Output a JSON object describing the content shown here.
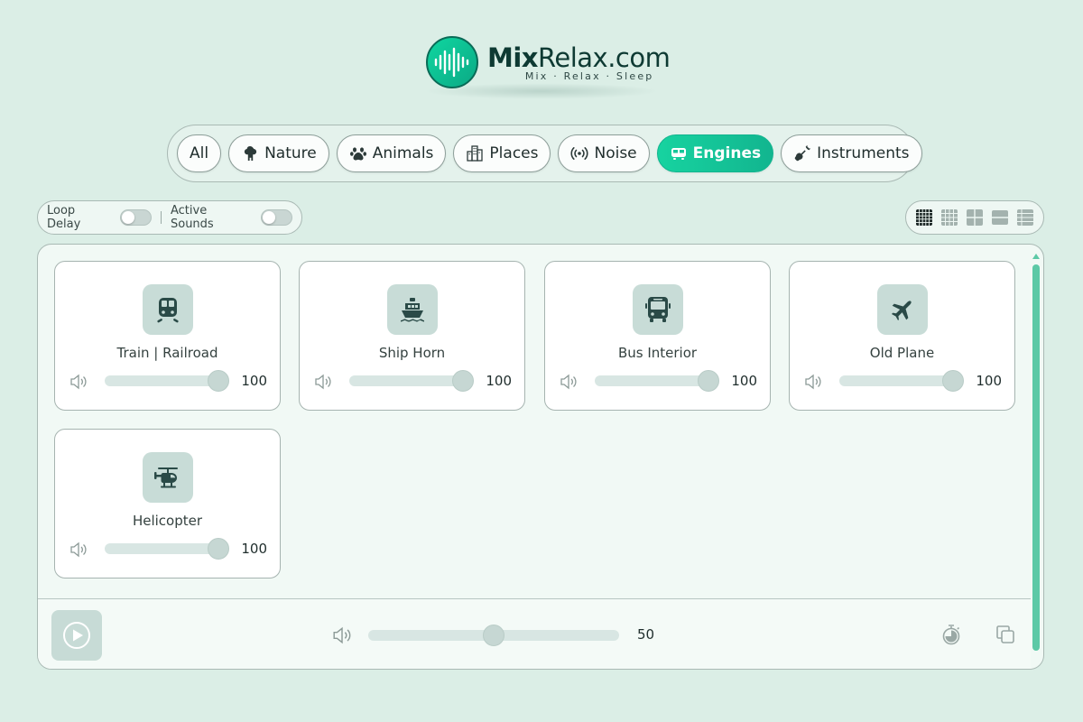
{
  "brand": {
    "name_bold": "Mix",
    "name_rest": "Relax.com",
    "tagline": "Mix · Relax · Sleep",
    "accent": "#14c89a"
  },
  "categories": [
    {
      "label": "All",
      "icon": "",
      "active": false
    },
    {
      "label": "Nature",
      "icon": "tree-icon",
      "active": false
    },
    {
      "label": "Animals",
      "icon": "paw-icon",
      "active": false
    },
    {
      "label": "Places",
      "icon": "city-icon",
      "active": false
    },
    {
      "label": "Noise",
      "icon": "broadcast-icon",
      "active": false
    },
    {
      "label": "Engines",
      "icon": "train-icon",
      "active": true
    },
    {
      "label": "Instruments",
      "icon": "guitar-icon",
      "active": false
    }
  ],
  "options": {
    "loop_delay_label": "Loop Delay",
    "loop_delay_on": false,
    "active_sounds_label": "Active Sounds",
    "active_sounds_on": false
  },
  "layout_icons": [
    "grid-5-icon",
    "grid-4-icon",
    "grid-2-icon",
    "rows-icon",
    "list-icon"
  ],
  "sounds": [
    {
      "name": "Train | Railroad",
      "icon": "train-icon",
      "volume": "100"
    },
    {
      "name": "Ship Horn",
      "icon": "ship-icon",
      "volume": "100"
    },
    {
      "name": "Bus Interior",
      "icon": "bus-icon",
      "volume": "100"
    },
    {
      "name": "Old Plane",
      "icon": "plane-icon",
      "volume": "100"
    },
    {
      "name": "Helicopter",
      "icon": "helicopter-icon",
      "volume": "100"
    }
  ],
  "master": {
    "volume": "50",
    "play_icon": "play-icon",
    "timer_icon": "timer-icon",
    "copy_icon": "copy-icon"
  }
}
